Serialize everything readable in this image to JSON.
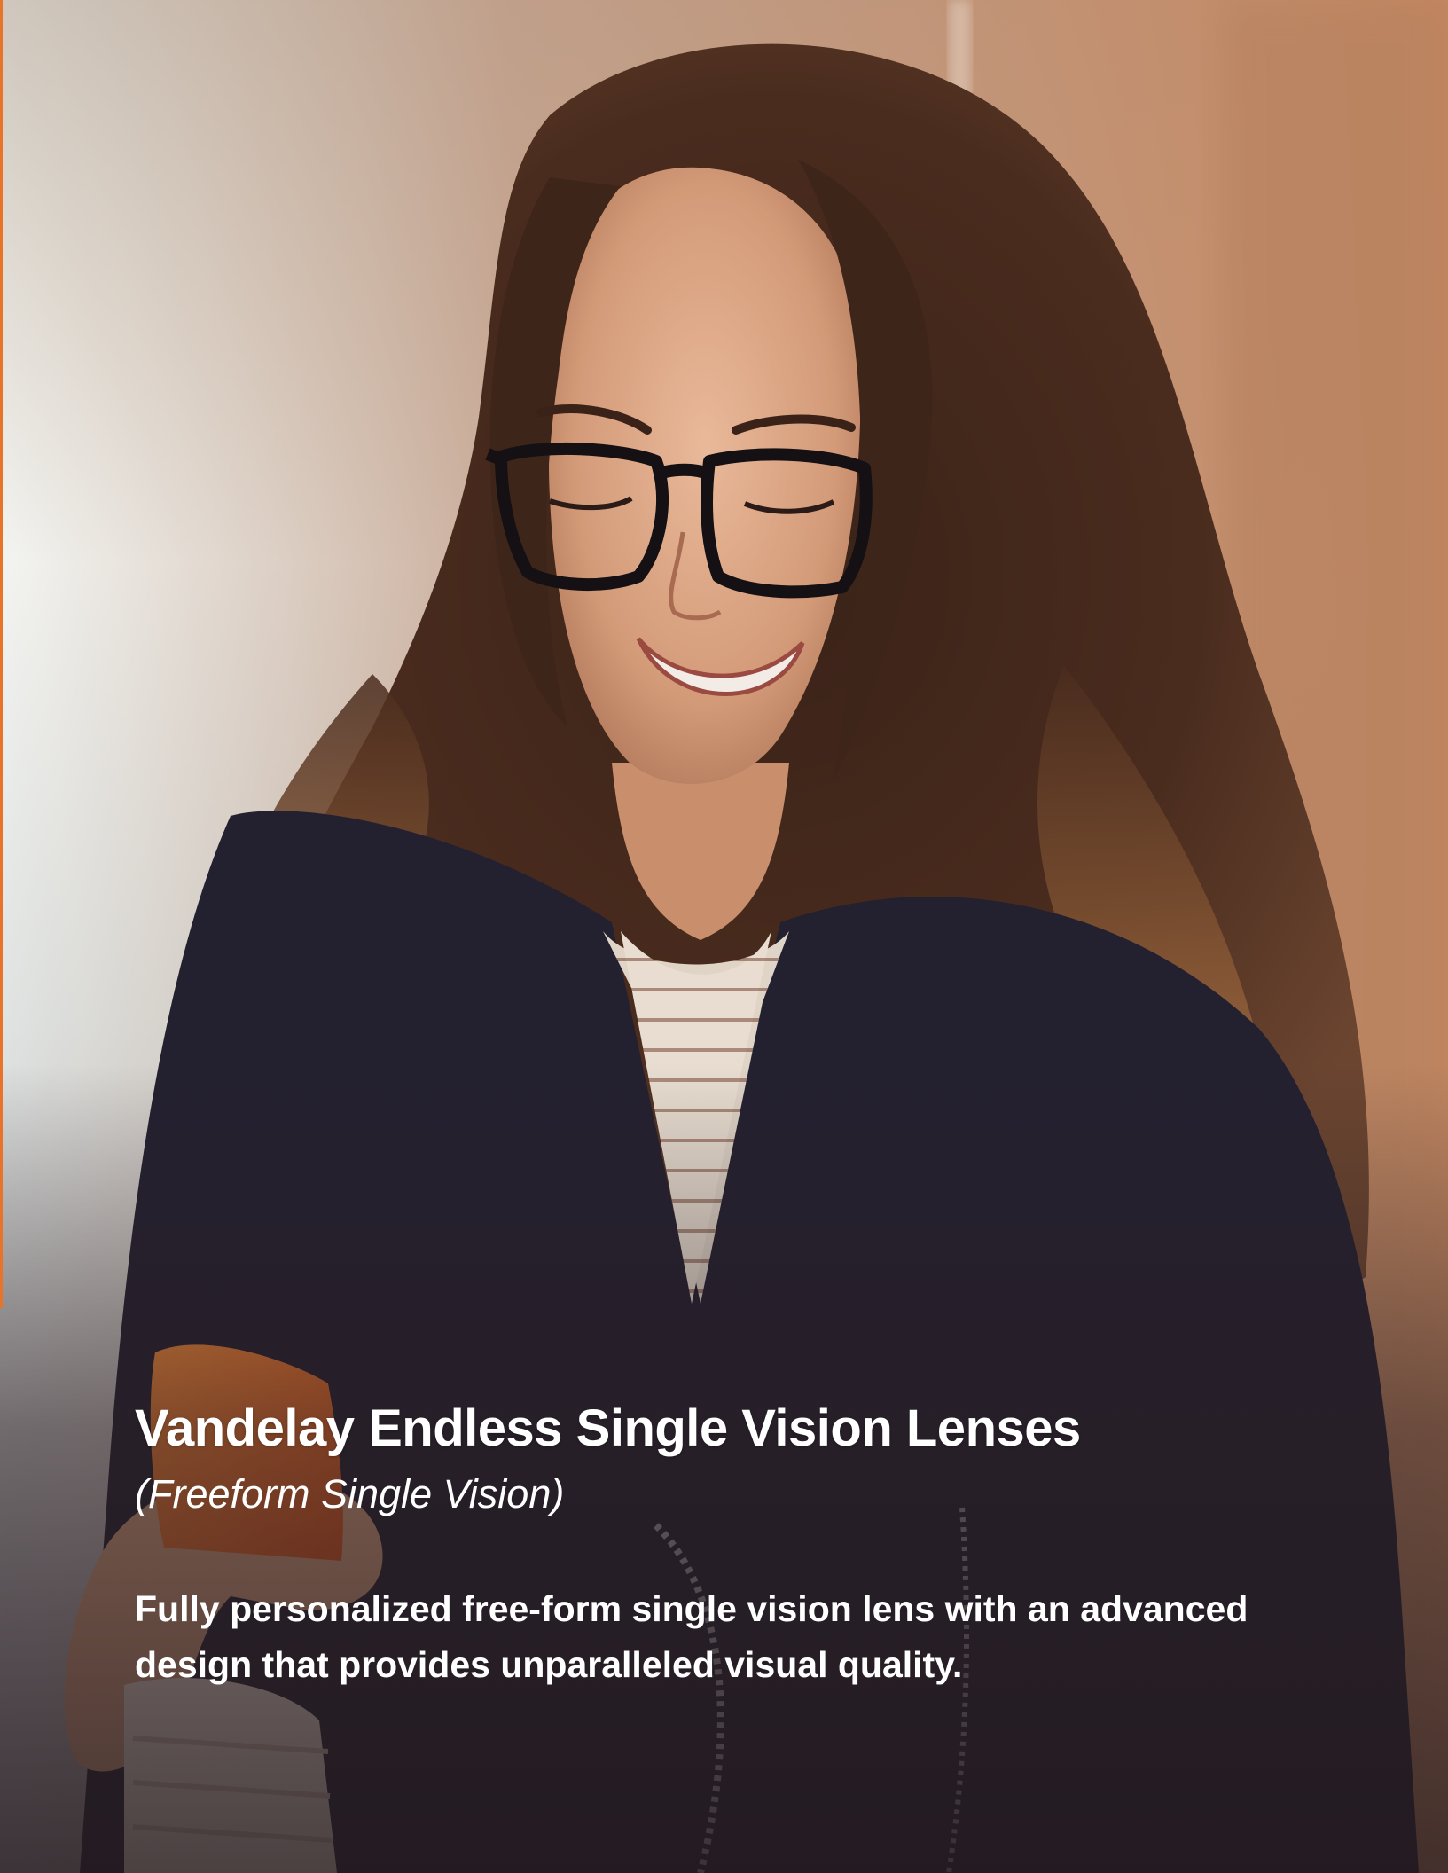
{
  "brand": {
    "accent_color": "#e8742a",
    "text_color": "#ffffff"
  },
  "hero": {
    "image_alt": "Woman with long curly hair wearing black-framed glasses smiling at an orange phone"
  },
  "copy": {
    "title": "Vandelay Endless Single Vision Lenses",
    "subtitle": "(Freeform Single Vision)",
    "description": "Fully personalized free-form single vision lens with an advanced design that provides unparalleled visual quality."
  }
}
